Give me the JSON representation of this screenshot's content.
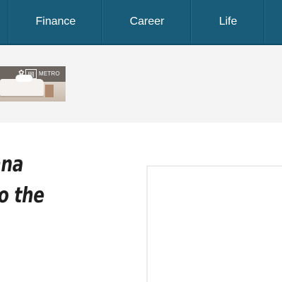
{
  "nav": {
    "items": [
      {
        "label": "Finance"
      },
      {
        "label": "Career"
      },
      {
        "label": "Life"
      }
    ]
  },
  "ad": {
    "brand_text": "METRO",
    "brand_glyph": "网"
  },
  "article": {
    "headline_lines": [
      "ana",
      "to the"
    ]
  },
  "colors": {
    "nav_bg": "#185c7a",
    "strip_bg": "#f4f4f4",
    "headline": "#1f1f1f"
  }
}
